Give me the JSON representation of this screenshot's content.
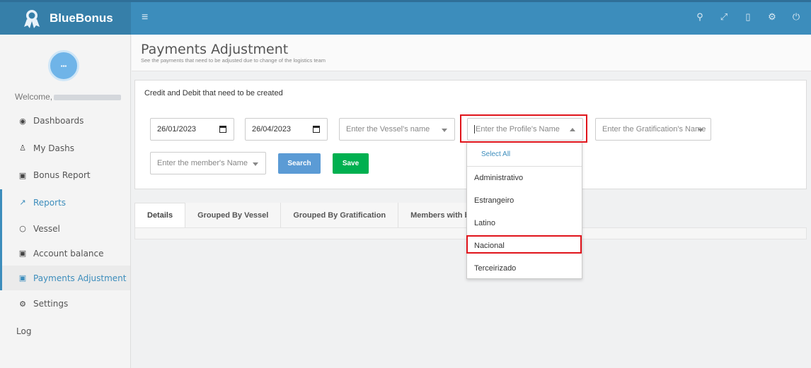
{
  "app": {
    "brand_prefix": "Blue",
    "brand_suffix": "Bonus"
  },
  "topbar": {
    "icons": [
      "search-icon",
      "expand-icon",
      "mobile-icon",
      "cogs-icon",
      "power-icon"
    ]
  },
  "sidebar": {
    "welcome": "Welcome,",
    "items": [
      {
        "label": "Dashboards",
        "icon": "dashboard-icon"
      },
      {
        "label": "My Dashs",
        "icon": "user-icon"
      },
      {
        "label": "Bonus Report",
        "icon": "money-icon"
      },
      {
        "label": "Reports",
        "icon": "chart-icon"
      },
      {
        "label": "Vessel",
        "icon": "circle-icon"
      },
      {
        "label": "Account balance",
        "icon": "money-icon"
      },
      {
        "label": "Payments Adjustment",
        "icon": "money-icon"
      },
      {
        "label": "Settings",
        "icon": "cogs-icon"
      },
      {
        "label": "Log",
        "icon": ""
      }
    ]
  },
  "header": {
    "title": "Payments Adjustment",
    "subtitle": "See the payments that need to be adjusted due to change of the logistics team"
  },
  "filters": {
    "box_title": "Credit and Debit that need to be created",
    "date_from": "26/01/2023",
    "date_to": "26/04/2023",
    "vessel_placeholder": "Enter the Vessel's name",
    "profile_placeholder": "Enter the Profile's Name",
    "gratification_placeholder": "Enter the Gratification's Name",
    "member_placeholder": "Enter the member's Name",
    "search_label": "Search",
    "save_label": "Save"
  },
  "tabs": [
    {
      "label": "Details"
    },
    {
      "label": "Grouped By Vessel"
    },
    {
      "label": "Grouped By Gratification"
    },
    {
      "label": "Members with big"
    }
  ],
  "dropdown": {
    "select_all": "Select All",
    "options": [
      "Administrativo",
      "Estrangeiro",
      "Latino",
      "Nacional",
      "Terceirizado"
    ]
  },
  "colors": {
    "primary": "#3c8dbc",
    "search_button": "#5b9bd5",
    "save_button": "#00b050",
    "highlight": "#e0141b"
  }
}
